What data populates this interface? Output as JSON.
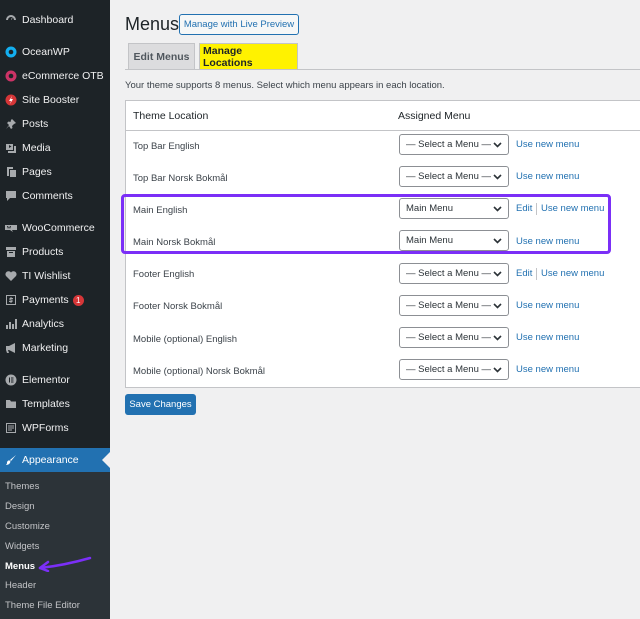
{
  "sidebar": {
    "items": [
      {
        "label": "Dashboard",
        "icon": "dashboard-icon"
      },
      {
        "label": "OceanWP",
        "icon": "oceanwp-icon"
      },
      {
        "label": "eCommerce OTB",
        "icon": "ecommerce-icon"
      },
      {
        "label": "Site Booster",
        "icon": "site-booster-icon"
      },
      {
        "label": "Posts",
        "icon": "pin-icon"
      },
      {
        "label": "Media",
        "icon": "media-icon"
      },
      {
        "label": "Pages",
        "icon": "pages-icon"
      },
      {
        "label": "Comments",
        "icon": "comment-icon"
      },
      {
        "label": "WooCommerce",
        "icon": "woocommerce-icon"
      },
      {
        "label": "Products",
        "icon": "products-icon"
      },
      {
        "label": "TI Wishlist",
        "icon": "heart-icon"
      },
      {
        "label": "Payments",
        "icon": "dollar-icon",
        "badge": "1"
      },
      {
        "label": "Analytics",
        "icon": "bar-chart-icon"
      },
      {
        "label": "Marketing",
        "icon": "megaphone-icon"
      },
      {
        "label": "Elementor",
        "icon": "elementor-icon"
      },
      {
        "label": "Templates",
        "icon": "folder-icon"
      },
      {
        "label": "WPForms",
        "icon": "wpforms-icon"
      },
      {
        "label": "Appearance",
        "icon": "paintbrush-icon"
      }
    ],
    "submenu": [
      "Themes",
      "Design",
      "Customize",
      "Widgets",
      "Menus",
      "Header",
      "Theme File Editor"
    ]
  },
  "header": {
    "title": "Menus",
    "preview_button": "Manage with Live Preview"
  },
  "tabs": [
    {
      "label": "Edit Menus"
    },
    {
      "label": "Manage Locations"
    }
  ],
  "description": "Your theme supports 8 menus. Select which menu appears in each location.",
  "table": {
    "col_location": "Theme Location",
    "col_menu": "Assigned Menu",
    "rows": [
      {
        "location": "Top Bar English",
        "selected": "— Select a Menu —",
        "edit": "",
        "new": "Use new menu"
      },
      {
        "location": "Top Bar Norsk Bokmål",
        "selected": "— Select a Menu —",
        "edit": "",
        "new": "Use new menu"
      },
      {
        "location": "Main English",
        "selected": "Main Menu",
        "edit": "Edit",
        "new": "Use new menu"
      },
      {
        "location": "Main Norsk Bokmål",
        "selected": "Main Menu",
        "edit": "",
        "new": "Use new menu"
      },
      {
        "location": "Footer English",
        "selected": "— Select a Menu —",
        "edit": "Edit",
        "new": "Use new menu"
      },
      {
        "location": "Footer Norsk Bokmål",
        "selected": "— Select a Menu —",
        "edit": "",
        "new": "Use new menu"
      },
      {
        "location": "Mobile (optional) English",
        "selected": "— Select a Menu —",
        "edit": "",
        "new": "Use new menu"
      },
      {
        "location": "Mobile (optional) Norsk Bokmål",
        "selected": "— Select a Menu —",
        "edit": "",
        "new": "Use new menu"
      }
    ]
  },
  "save_button": "Save Changes",
  "colors": {
    "accent": "#2271b1",
    "highlight": "#7b2ff7",
    "tab_highlight": "#fff200"
  }
}
